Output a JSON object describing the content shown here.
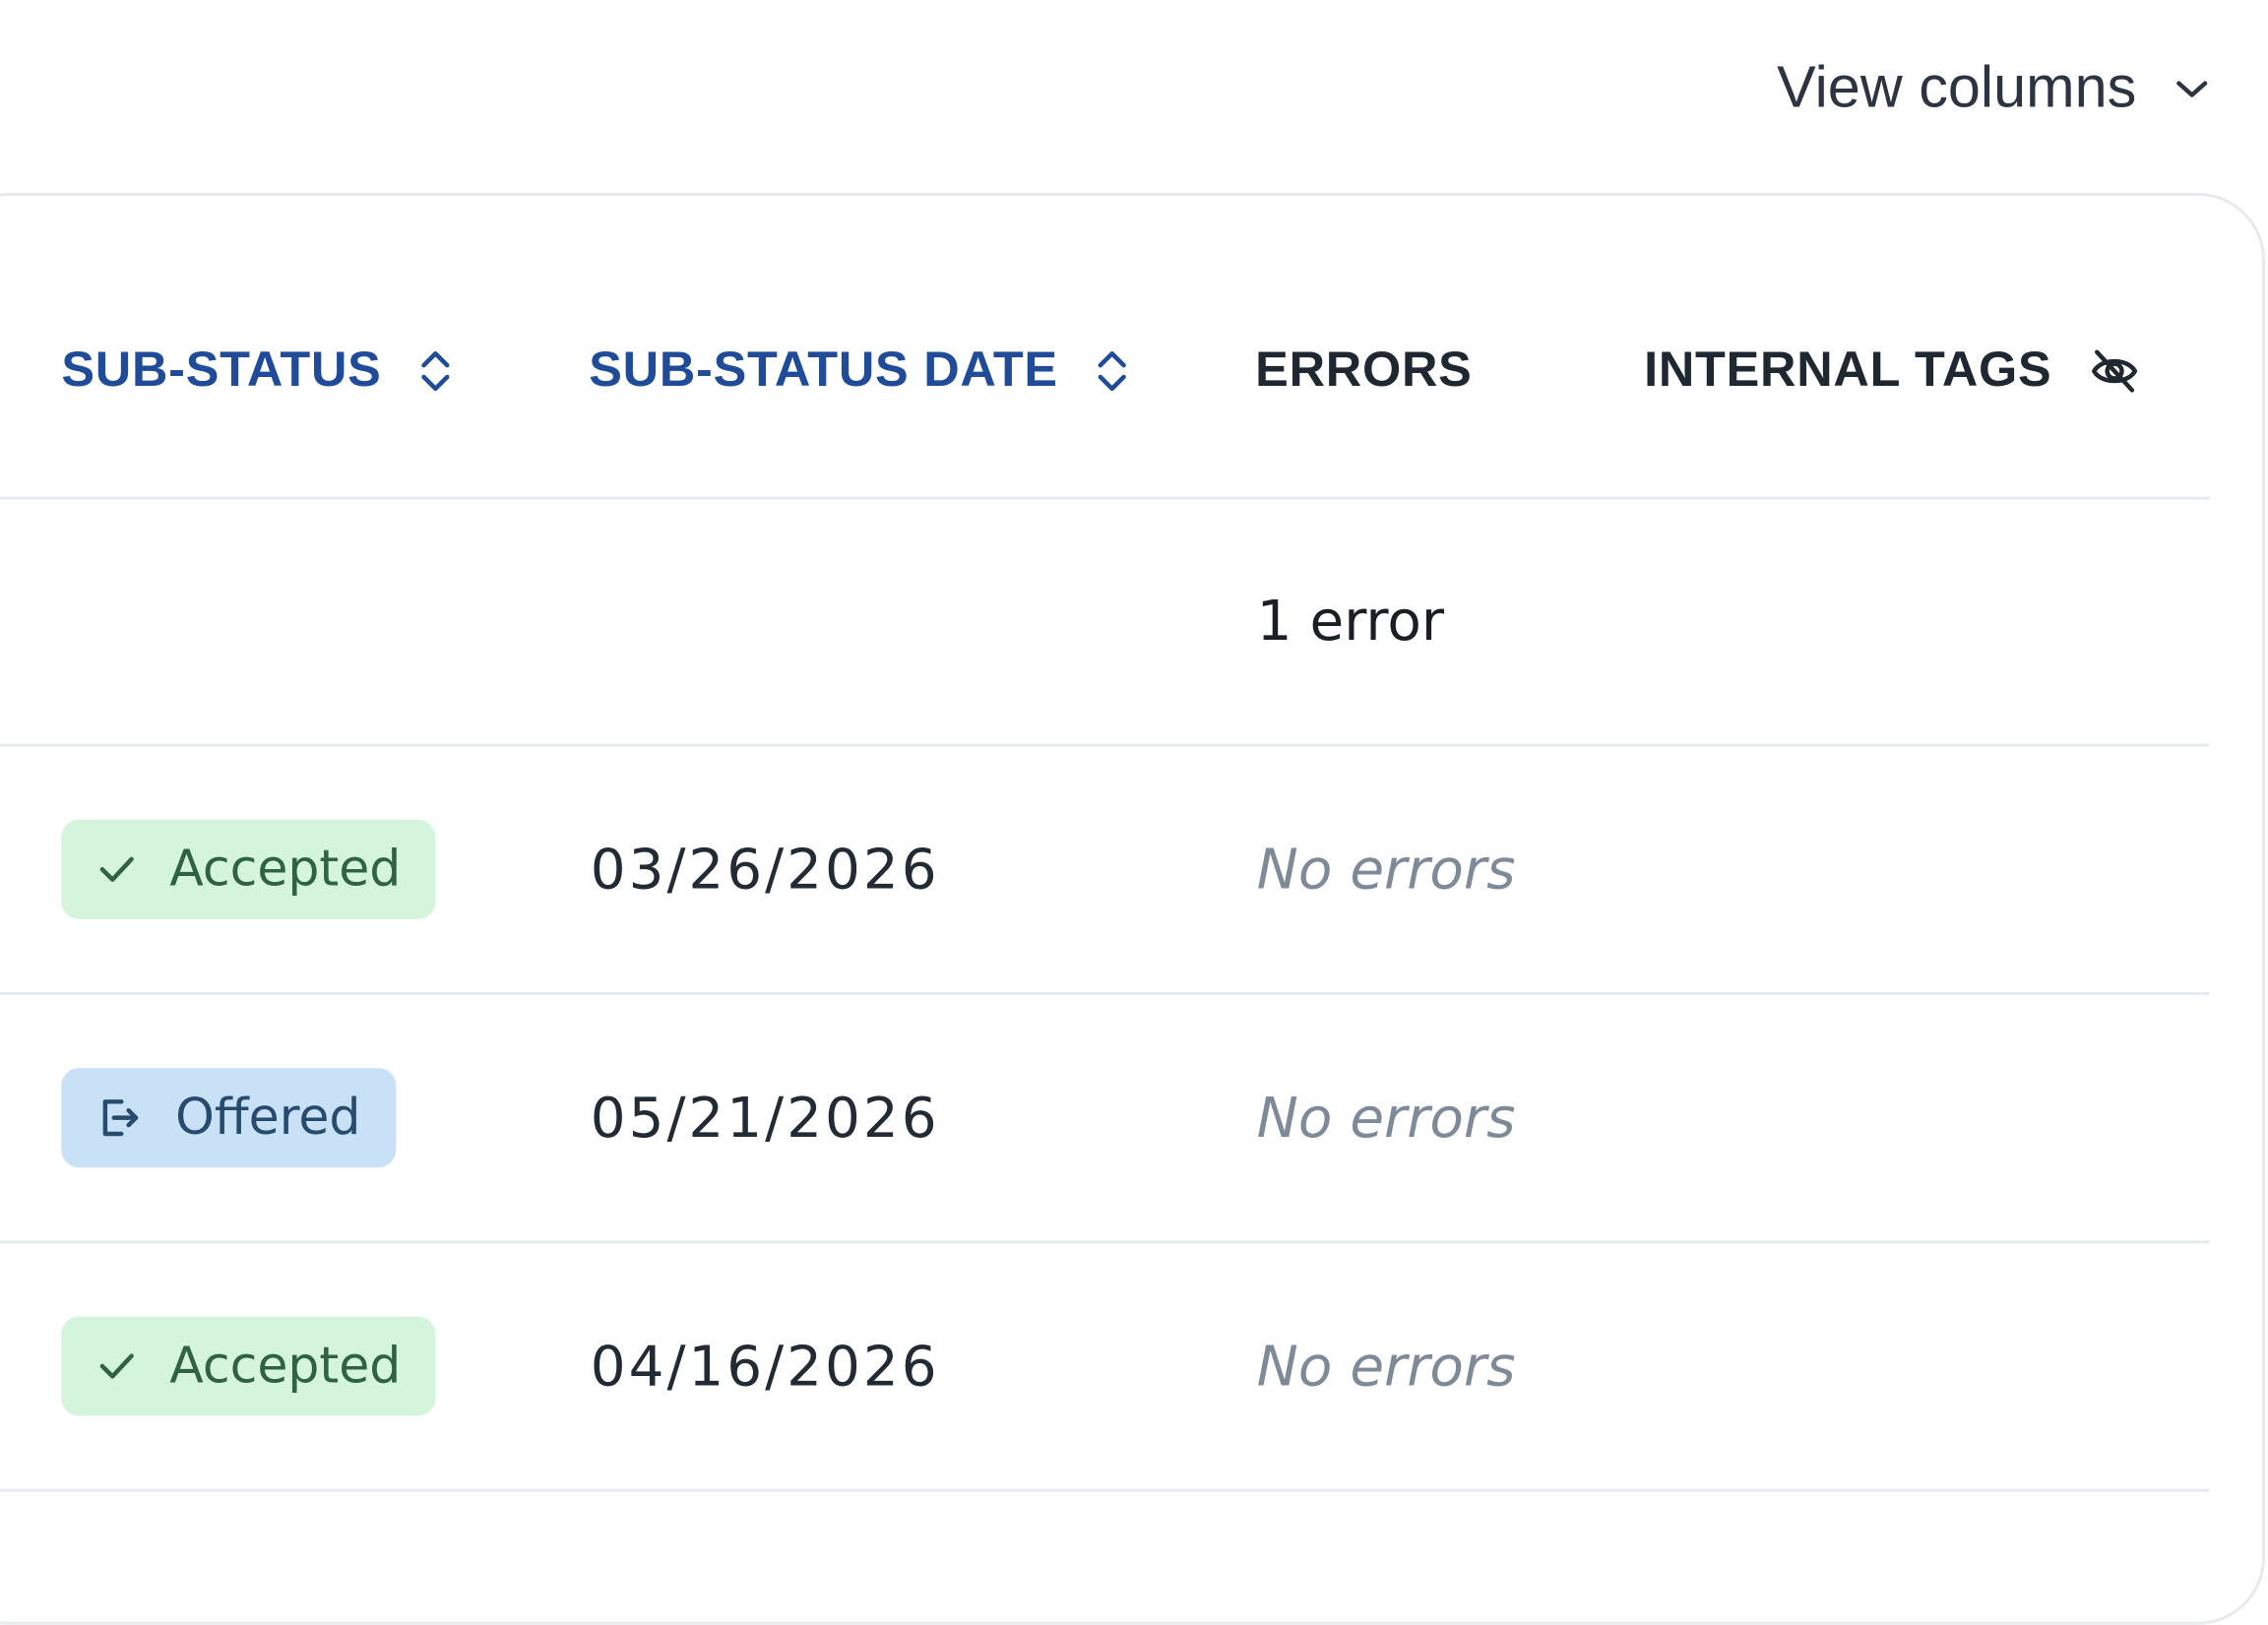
{
  "toolbar": {
    "view_columns_label": "View columns",
    "view_columns_icon": "chevron-down-icon"
  },
  "table": {
    "columns": [
      {
        "label": "SUB-STATUS",
        "sortable": true,
        "icon": "sort-icon"
      },
      {
        "label": "SUB-STATUS DATE",
        "sortable": true,
        "icon": "sort-icon"
      },
      {
        "label": "ERRORS",
        "sortable": false
      },
      {
        "label": "INTERNAL TAGS",
        "sortable": false,
        "icon": "eye-off-icon"
      }
    ],
    "rows": [
      {
        "sub_status": "",
        "sub_status_date": "",
        "errors": "1 error",
        "internal_tags": ""
      },
      {
        "sub_status": "Accepted",
        "sub_status_icon": "check-icon",
        "sub_status_date": "03/26/2026",
        "errors": "No errors",
        "internal_tags": ""
      },
      {
        "sub_status": "Offered",
        "sub_status_icon": "exit-door-icon",
        "sub_status_date": "05/21/2026",
        "errors": "No errors",
        "internal_tags": ""
      },
      {
        "sub_status": "Accepted",
        "sub_status_icon": "check-icon",
        "sub_status_date": "04/16/2026",
        "errors": "No errors",
        "internal_tags": ""
      }
    ]
  },
  "colors": {
    "sortable_header": "#1f4b99",
    "accepted_bg": "#d4f4dc",
    "offered_bg": "#c8e1f6",
    "muted_text": "#7f8a99"
  }
}
